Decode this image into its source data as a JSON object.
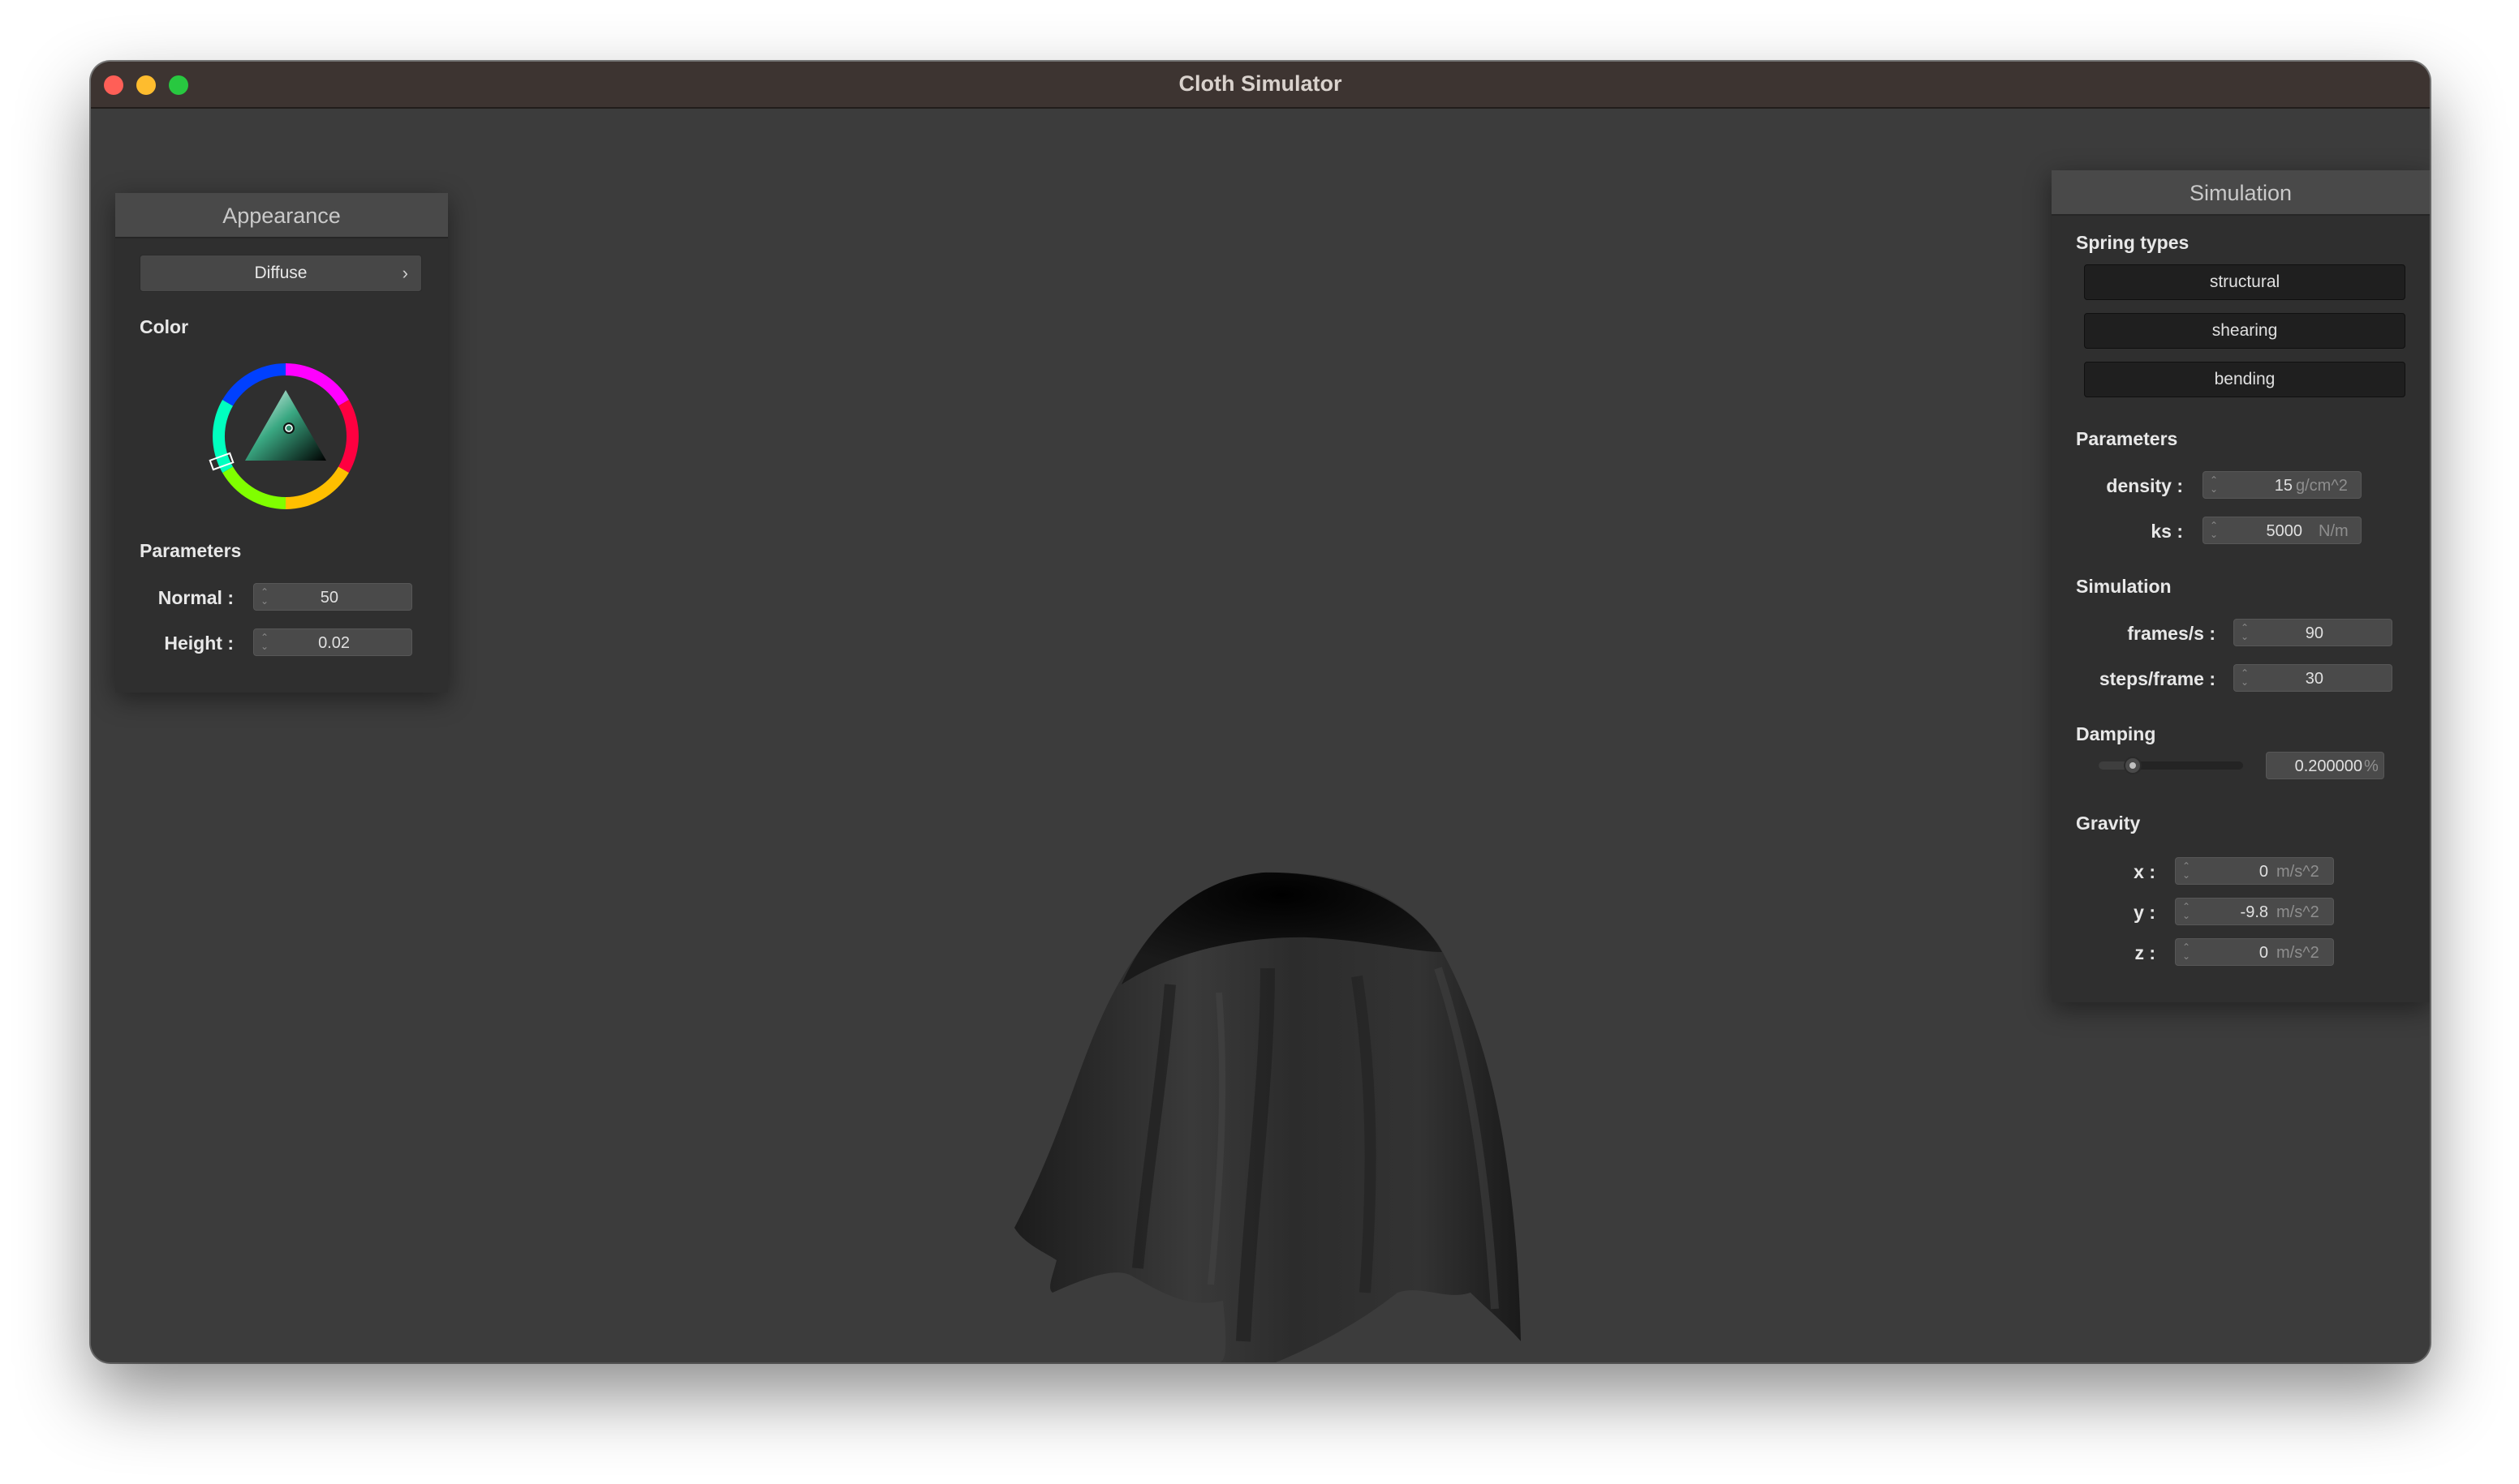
{
  "window": {
    "title": "Cloth Simulator"
  },
  "appearance": {
    "title": "Appearance",
    "shader_select": "Diffuse",
    "color_label": "Color",
    "parameters_label": "Parameters",
    "normal_label": "Normal :",
    "normal_value": "50",
    "height_label": "Height :",
    "height_value": "0.02"
  },
  "simulation": {
    "title": "Simulation",
    "spring_types_label": "Spring types",
    "springs": [
      "structural",
      "shearing",
      "bending"
    ],
    "parameters_label": "Parameters",
    "density_label": "density :",
    "density_value": "15",
    "density_unit": "g/cm^2",
    "ks_label": "ks :",
    "ks_value": "5000",
    "ks_unit": "N/m",
    "sim_label": "Simulation",
    "fps_label": "frames/s :",
    "fps_value": "90",
    "steps_label": "steps/frame :",
    "steps_value": "30",
    "damping_label": "Damping",
    "damping_value": "0.200000",
    "damping_unit": "%",
    "damping_slider_fraction": 0.2,
    "gravity_label": "Gravity",
    "gx_label": "x :",
    "gx_value": "0",
    "gy_label": "y :",
    "gy_value": "-9.8",
    "gz_label": "z :",
    "gz_value": "0",
    "gravity_unit": "m/s^2"
  },
  "colors": {
    "viewport_bg": "#3c3c3c",
    "cloth": "#2a2a2a",
    "selected_color": "#3aa882"
  }
}
